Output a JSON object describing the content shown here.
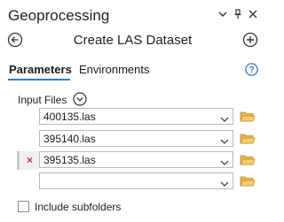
{
  "window": {
    "title": "Geoprocessing",
    "controls": {
      "options_icon": "chevron-down-icon",
      "pin_icon": "pin-icon",
      "close_icon": "close-icon"
    }
  },
  "tool": {
    "name": "Create LAS Dataset",
    "back_icon": "back-arrow-icon",
    "add_icon": "add-icon"
  },
  "tabs": [
    {
      "label": "Parameters",
      "active": true
    },
    {
      "label": "Environments",
      "active": false
    }
  ],
  "help_icon": "help-icon",
  "input_files": {
    "label": "Input Files",
    "files": [
      {
        "value": "400135.las",
        "remove_shown": false
      },
      {
        "value": "395140.las",
        "remove_shown": false
      },
      {
        "value": "395135.las",
        "remove_shown": true,
        "remove_glyph": "×"
      },
      {
        "value": "",
        "remove_shown": false
      }
    ]
  },
  "include_subfolders": {
    "label": "Include subfolders",
    "checked": false
  },
  "colors": {
    "accent": "#2f7ad6",
    "folder": "#e8b54a",
    "remove": "#c0392b"
  }
}
